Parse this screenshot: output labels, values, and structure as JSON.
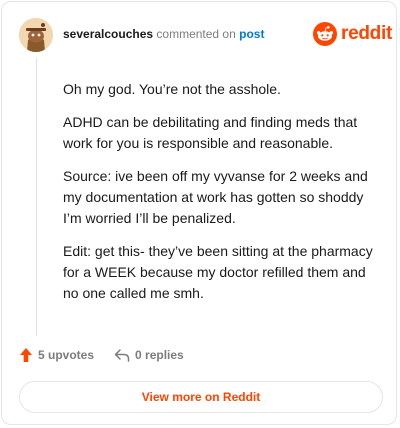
{
  "comment": {
    "username": "severalcouches",
    "action_text": "commented on",
    "post_label": "post",
    "paragraphs": [
      "Oh my god. You’re not the asshole.",
      "ADHD can be debilitating and finding meds that work for you is responsible and reasonable.",
      "Source: ive been off my vyvanse for 2 weeks and my documentation at work has gotten so shoddy I’m worried I’ll be penalized.",
      "Edit: get this- they’ve been sitting at the pharmacy for a WEEK because my doctor refilled them and no one called me smh."
    ],
    "upvotes": "5 upvotes",
    "replies": "0 replies"
  },
  "brand": {
    "name": "reddit",
    "color": "#ff4500"
  },
  "cta": {
    "label": "View more on Reddit"
  },
  "icons": {
    "avatar": "snoo-avatar",
    "logo": "reddit-snoo-icon",
    "upvote": "upvote-arrow-icon",
    "reply": "reply-arrow-icon"
  },
  "colors": {
    "link": "#0079d3",
    "accent": "#ff4500",
    "muted": "#7c7c7c"
  }
}
